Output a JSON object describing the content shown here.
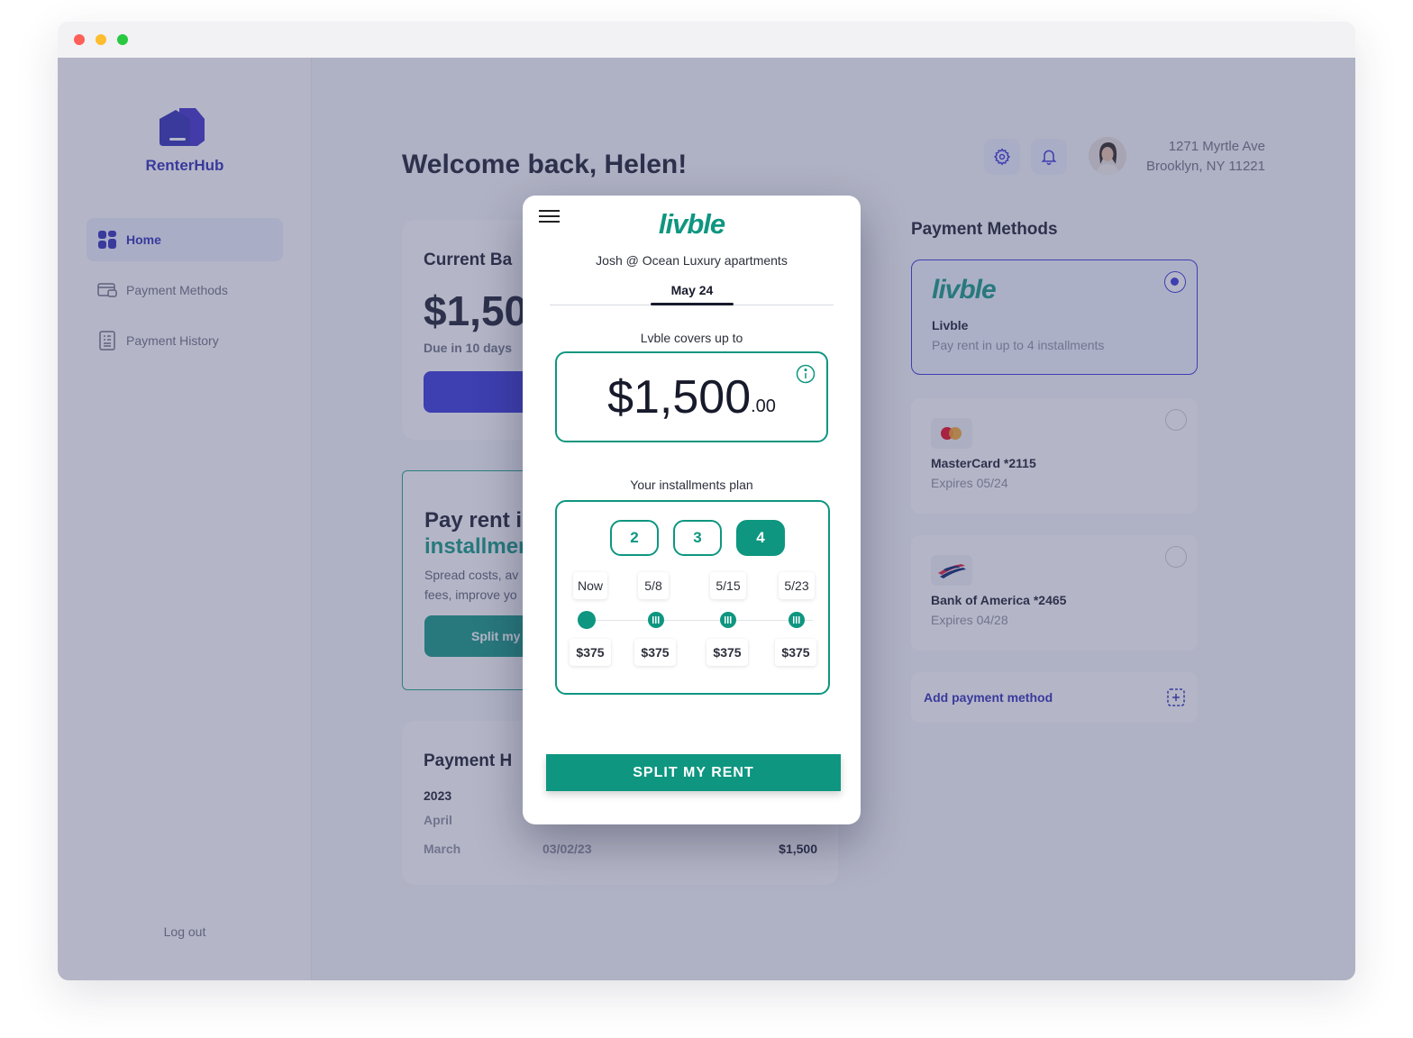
{
  "app": {
    "brand": "RenterHub",
    "brand_color": "#2c2ab5",
    "accent_color": "#0e9680"
  },
  "sidebar": {
    "items": [
      {
        "label": "Home",
        "icon": "grid-icon",
        "active": true
      },
      {
        "label": "Payment Methods",
        "icon": "card-icon",
        "active": false
      },
      {
        "label": "Payment History",
        "icon": "receipt-icon",
        "active": false
      }
    ],
    "logout": "Log out"
  },
  "header": {
    "welcome": "Welcome back, Helen!",
    "address_line1": "1271 Myrtle Ave",
    "address_line2": "Brooklyn, NY 11221"
  },
  "balance_card": {
    "title": "Current Ba",
    "amount": "$1,50",
    "due": "Due in 10 days"
  },
  "promo_card": {
    "title_line1": "Pay rent i",
    "title_line2": "installmer",
    "text_line1": "Spread costs, av",
    "text_line2": "fees, improve yo",
    "button": "Split my"
  },
  "history_card": {
    "title": "Payment H",
    "year": "2023",
    "rows": [
      {
        "month": "April",
        "date": "",
        "amount": ""
      },
      {
        "month": "March",
        "date": "03/02/23",
        "amount": "$1,500"
      }
    ]
  },
  "payment_methods": {
    "title": "Payment Methods",
    "methods": [
      {
        "logo_text": "livble",
        "name": "Livble",
        "sub": "Pay rent in up to 4 installments",
        "selected": true
      },
      {
        "logo": "mastercard-icon",
        "name": "MasterCard *2115",
        "sub": "Expires 05/24",
        "selected": false
      },
      {
        "logo": "bank-of-america-icon",
        "name": "Bank of America *2465",
        "sub": "Expires 04/28",
        "selected": false
      }
    ],
    "add_label": "Add payment method"
  },
  "modal": {
    "logo": "livble",
    "subtitle": "Josh @ Ocean Luxury apartments",
    "tab": "May 24",
    "covers_label": "Lvble covers up to",
    "amount_main": "$1,500",
    "amount_cents": ".00",
    "plan_label": "Your installments plan",
    "options": [
      "2",
      "3",
      "4"
    ],
    "selected_option": "4",
    "schedule": [
      {
        "date": "Now",
        "amount": "$375"
      },
      {
        "date": "5/8",
        "amount": "$375"
      },
      {
        "date": "5/15",
        "amount": "$375"
      },
      {
        "date": "5/23",
        "amount": "$375"
      }
    ],
    "cta": "SPLIT MY RENT"
  }
}
